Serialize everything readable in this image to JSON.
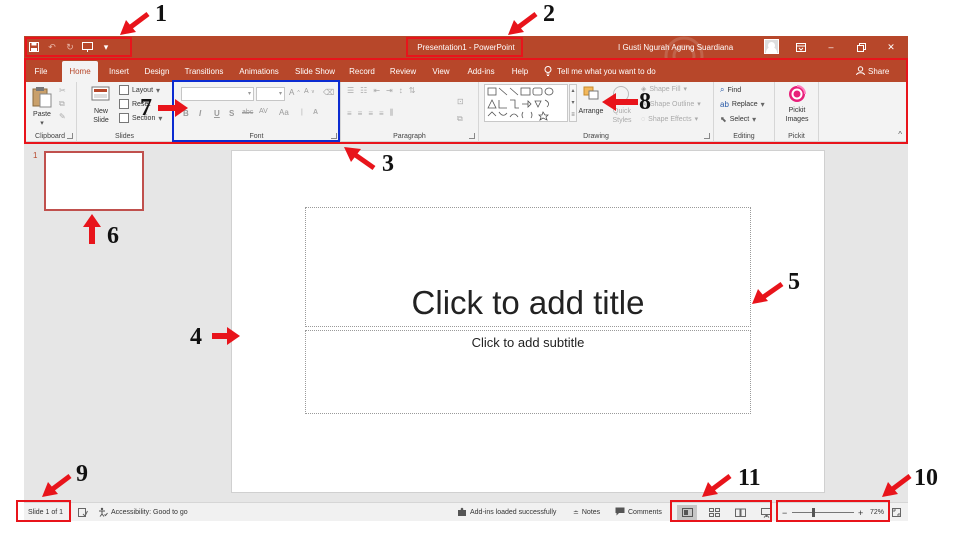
{
  "titlebar": {
    "document_title": "Presentation1  -  PowerPoint",
    "user_name": "I Gusti Ngurah Agung Suardiana",
    "quick_access": [
      "save-icon",
      "undo-icon",
      "redo-icon",
      "start-from-beginning-icon",
      "customize-qat-icon"
    ],
    "window_controls": [
      "ribbon-display-options-icon",
      "minimize-icon",
      "restore-icon",
      "close-icon"
    ],
    "colors": {
      "accent": "#b7472a"
    }
  },
  "tabs": {
    "items": [
      "File",
      "Home",
      "Insert",
      "Design",
      "Transitions",
      "Animations",
      "Slide Show",
      "Record",
      "Review",
      "View",
      "Add-ins",
      "Help"
    ],
    "active": "Home",
    "tell_me": "Tell me what you want to do",
    "share": "Share"
  },
  "ribbon": {
    "clipboard": {
      "label": "Clipboard",
      "paste": "Paste"
    },
    "slides": {
      "label": "Slides",
      "new_slide": "New",
      "new_slide_2": "Slide",
      "layout": "Layout",
      "reset": "Reset",
      "section": "Section"
    },
    "font": {
      "label": "Font",
      "font_name": "",
      "font_size": "",
      "buttons": [
        "B",
        "I",
        "U",
        "S",
        "abc",
        "AV",
        "Aa"
      ]
    },
    "paragraph": {
      "label": "Paragraph"
    },
    "drawing": {
      "label": "Drawing",
      "arrange": "Arrange",
      "quick_styles": "Quick Styles",
      "shape_fill": "Shape Fill",
      "shape_outline": "Shape Outline",
      "shape_effects": "Shape Effects"
    },
    "editing": {
      "label": "Editing",
      "find": "Find",
      "replace": "Replace",
      "select": "Select"
    },
    "pickit": {
      "label": "Pickit",
      "button": "Pickit Images",
      "line1": "Pickit",
      "line2": "Images"
    }
  },
  "slide_panel": {
    "thumbnail_number": "1"
  },
  "slide": {
    "title_placeholder": "Click to add title",
    "subtitle_placeholder": "Click to add subtitle"
  },
  "statusbar": {
    "slide_counter": "Slide 1 of 1",
    "accessibility": "Accessibility: Good to go",
    "addins": "Add-ins loaded successfully",
    "notes": "Notes",
    "comments": "Comments",
    "zoom": "72%",
    "zoom_level": 0.72
  },
  "annotations": {
    "numbers": [
      "1",
      "2",
      "3",
      "4",
      "5",
      "6",
      "7",
      "8",
      "9",
      "10",
      "11"
    ],
    "colors": {
      "red": "#e8141b",
      "blue": "#0b2bd1"
    }
  }
}
